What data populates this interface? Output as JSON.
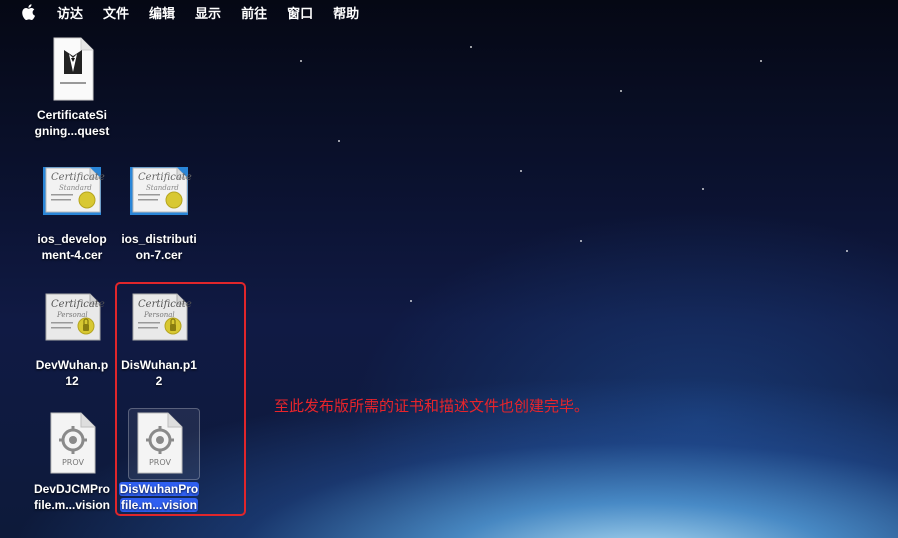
{
  "menubar": {
    "items": [
      "访达",
      "文件",
      "编辑",
      "显示",
      "前往",
      "窗口",
      "帮助"
    ]
  },
  "desktop": {
    "icons": [
      {
        "name": "CertificateSigning...quest",
        "line1": "CertificateSi",
        "line2": "gning...quest",
        "type": "request"
      },
      {
        "name": "ios_development-4.cer",
        "line1": "ios_develop",
        "line2": "ment-4.cer",
        "type": "certificate",
        "cert_word": "Certificate",
        "cert_sub": "Standard"
      },
      {
        "name": "ios_distribution-7.cer",
        "line1": "ios_distributi",
        "line2": "on-7.cer",
        "type": "certificate",
        "cert_word": "Certificate",
        "cert_sub": "Standard"
      },
      {
        "name": "DevWuhan.p12",
        "line1": "DevWuhan.p",
        "line2": "12",
        "type": "personal",
        "cert_word": "Certificate",
        "cert_sub": "Personal"
      },
      {
        "name": "DisWuhan.p12",
        "line1": "DisWuhan.p1",
        "line2": "2",
        "type": "personal",
        "cert_word": "Certificate",
        "cert_sub": "Personal"
      },
      {
        "name": "DevDJCMProfile.m...vision",
        "line1": "DevDJCMPro",
        "line2": "file.m...vision",
        "type": "profile",
        "badge": "PROV"
      },
      {
        "name": "DisWuhanProfile.m...vision",
        "line1": "DisWuhanPro",
        "line2": "file.m...vision",
        "type": "profile",
        "badge": "PROV",
        "selected": true
      }
    ]
  },
  "annotation": {
    "text": "至此发布版所需的证书和描述文件也创建完毕。",
    "color": "#e0262b"
  },
  "colors": {
    "selection": "#2f5ff0",
    "cert_seal": "#d8c832"
  }
}
